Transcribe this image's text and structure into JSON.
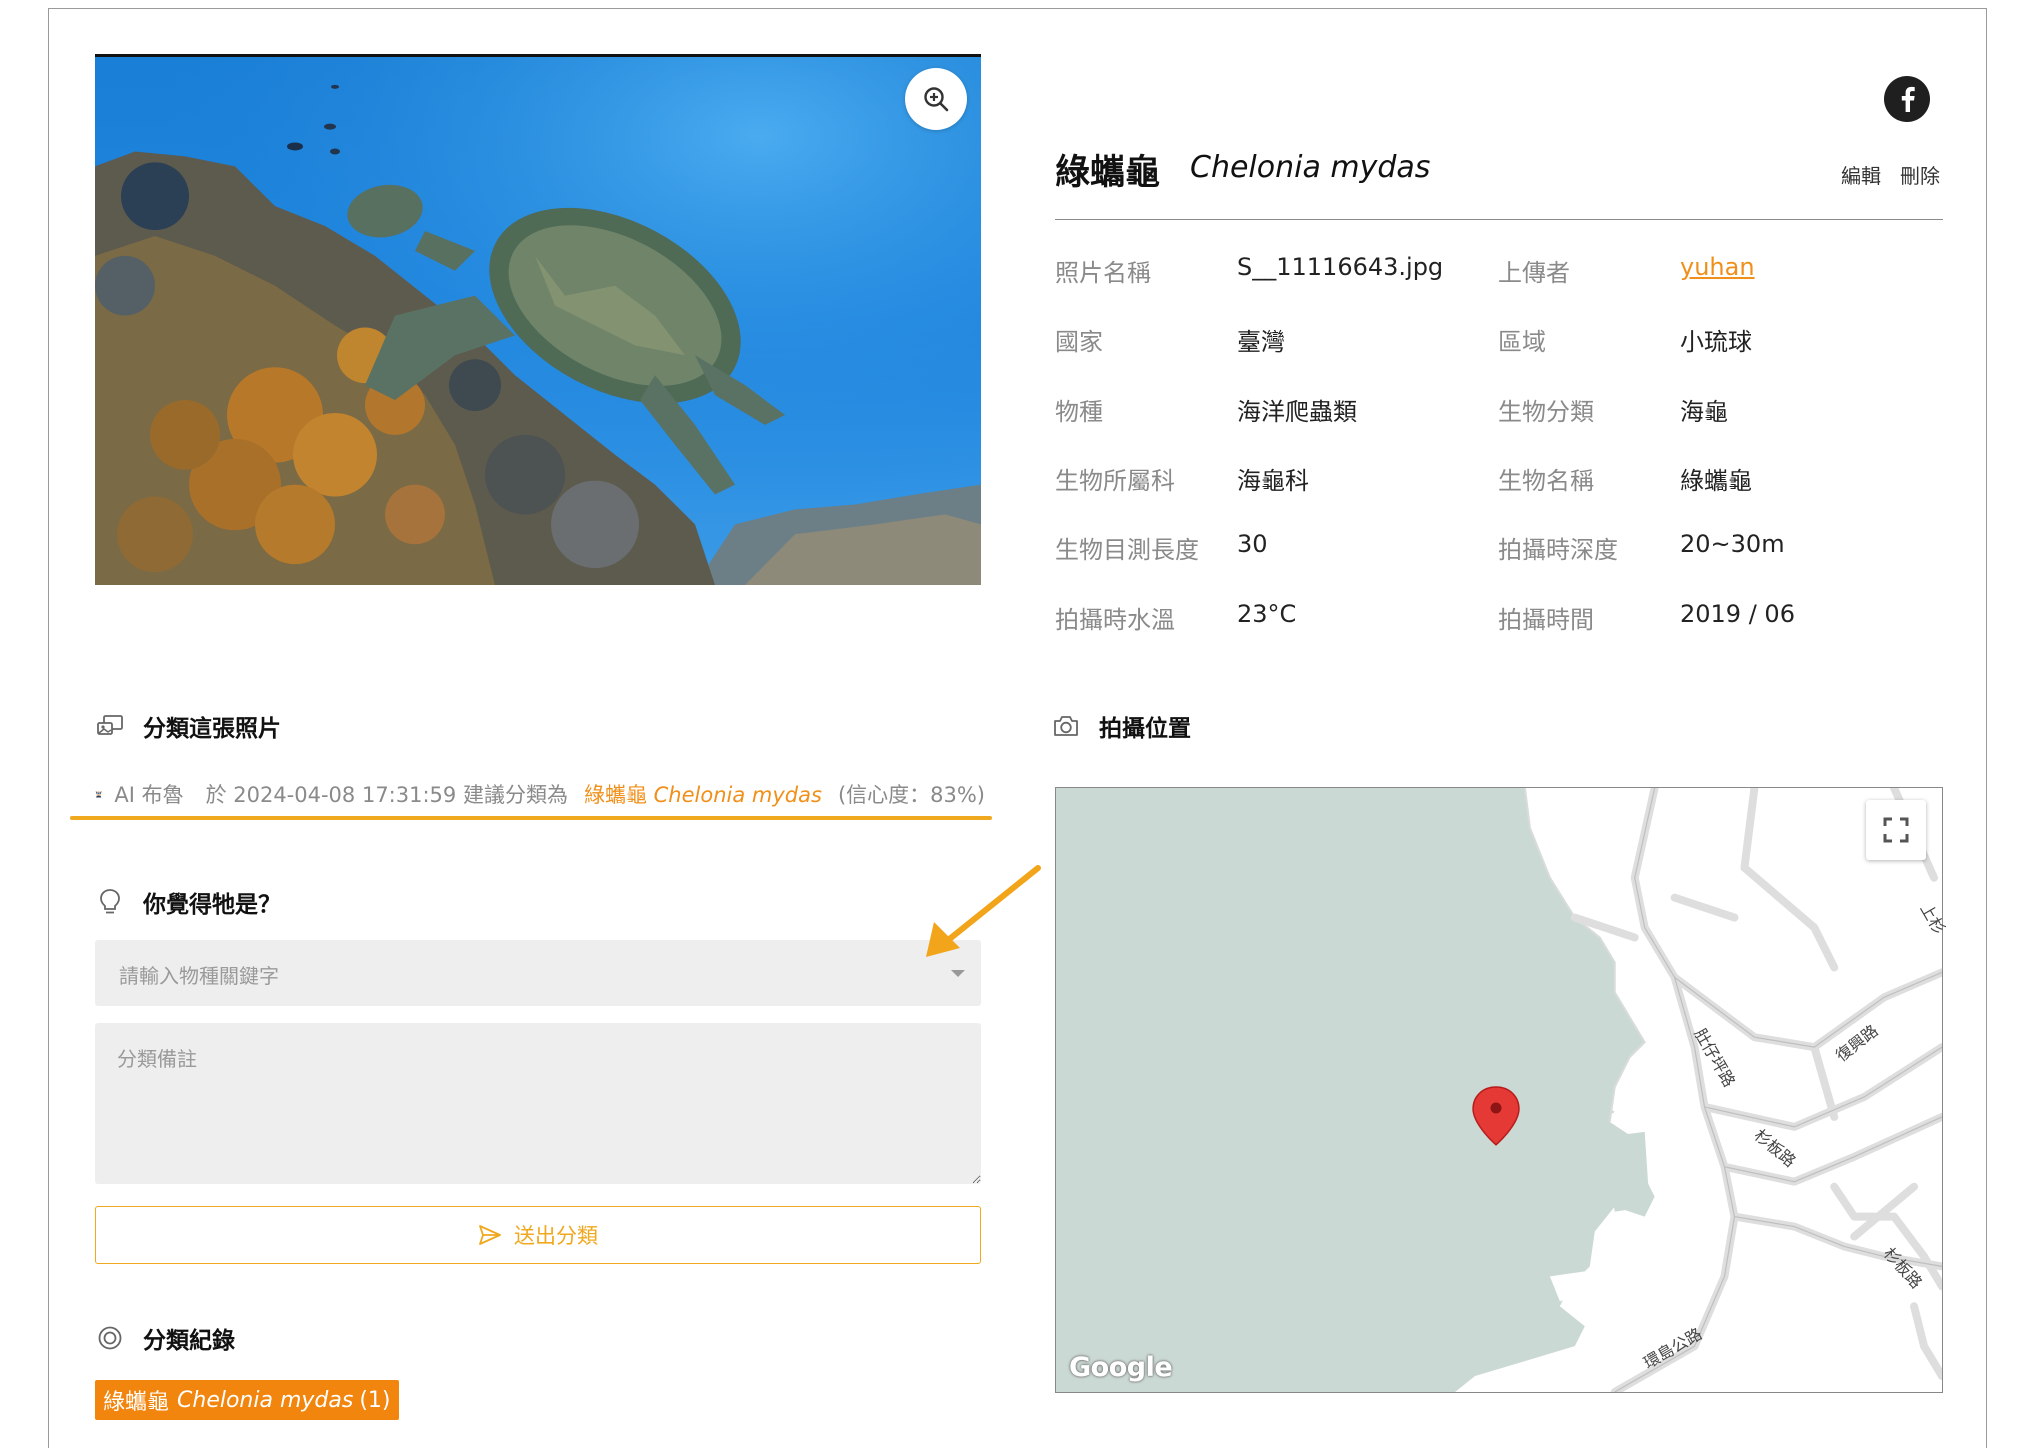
{
  "photo": {
    "zoom_icon": "zoom-in-icon"
  },
  "share": {
    "icon": "facebook-icon"
  },
  "title": {
    "name_zh": "綠蠵龜",
    "name_sci": "Chelonia mydas"
  },
  "actions": {
    "edit": "編輯",
    "delete": "刪除"
  },
  "info": [
    {
      "k": "照片名稱",
      "v": "S__11116643.jpg"
    },
    {
      "k": "上傳者",
      "v": "yuhan"
    },
    {
      "k": "國家",
      "v": "臺灣"
    },
    {
      "k": "區域",
      "v": "小琉球"
    },
    {
      "k": "物種",
      "v": "海洋爬蟲類"
    },
    {
      "k": "生物分類",
      "v": "海龜"
    },
    {
      "k": "生物所屬科",
      "v": "海龜科"
    },
    {
      "k": "生物名稱",
      "v": "綠蠵龜"
    },
    {
      "k": "生物目測長度",
      "v": "30"
    },
    {
      "k": "拍攝時深度",
      "v": "20~30m"
    },
    {
      "k": "拍攝時水溫",
      "v": "23°C"
    },
    {
      "k": "拍攝時間",
      "v": "2019 / 06"
    }
  ],
  "classify": {
    "heading": "分類這張照片",
    "ai_name": "AI 布魯",
    "ai_time": "於 2024-04-08 17:31:59 建議分類為",
    "ai_suggest_zh": "綠蠵龜",
    "ai_suggest_sci": "Chelonia mydas",
    "ai_confidence": "(信心度：83%)"
  },
  "guess": {
    "heading": "你覺得牠是？",
    "select_placeholder": "請輸入物種關鍵字",
    "note_placeholder": "分類備註",
    "submit": "送出分類"
  },
  "record": {
    "heading": "分類紀錄",
    "tag_zh": "綠蠵龜",
    "tag_sci": "Chelonia mydas",
    "tag_count": "(1)"
  },
  "location": {
    "heading": "拍攝位置",
    "brand": "Google",
    "streets": [
      "肚仔坪路",
      "復興路",
      "杉板路",
      "杉板路",
      "環島公路",
      "上杉"
    ]
  },
  "colors": {
    "accent": "#f0901a",
    "tag_bg": "#f2850d",
    "sea": "#cbd9d5"
  }
}
